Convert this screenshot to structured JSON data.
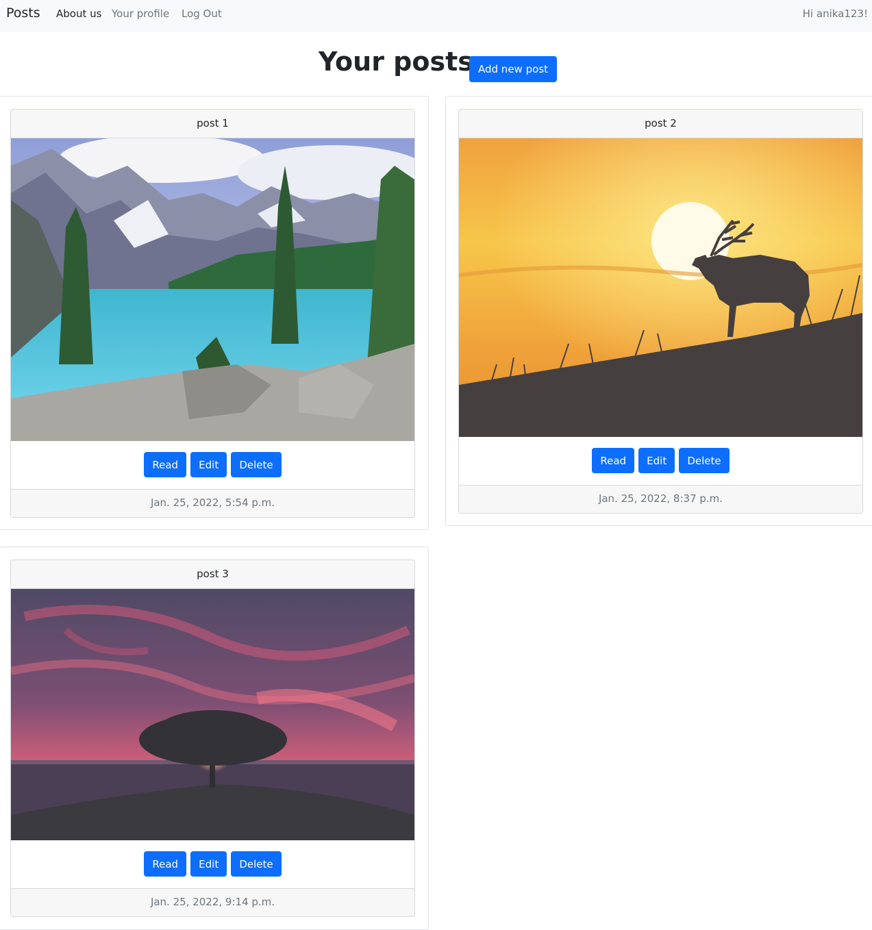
{
  "navbar": {
    "brand": "Posts",
    "links": [
      {
        "label": "About us",
        "active": true
      },
      {
        "label": "Your profile",
        "active": false
      },
      {
        "label": "Log Out",
        "active": false
      }
    ],
    "greeting": "Hi anika123!"
  },
  "page": {
    "title": "Your posts",
    "add_button": "Add new post"
  },
  "posts": [
    {
      "title": "post 1",
      "image": "mountain-lake-photo",
      "date": "Jan. 25, 2022, 5:54 p.m.",
      "read": "Read",
      "edit": "Edit",
      "delete": "Delete"
    },
    {
      "title": "post 2",
      "image": "deer-sunset-silhouette-illustration",
      "date": "Jan. 25, 2022, 8:37 p.m.",
      "read": "Read",
      "edit": "Edit",
      "delete": "Delete"
    },
    {
      "title": "post 3",
      "image": "tree-sunset-sea-photo",
      "date": "Jan. 25, 2022, 9:14 p.m.",
      "read": "Read",
      "edit": "Edit",
      "delete": "Delete"
    }
  ],
  "colors": {
    "primary": "#0d6efd",
    "navbar_bg": "#f8f9fa",
    "muted_text": "#6c757d"
  }
}
